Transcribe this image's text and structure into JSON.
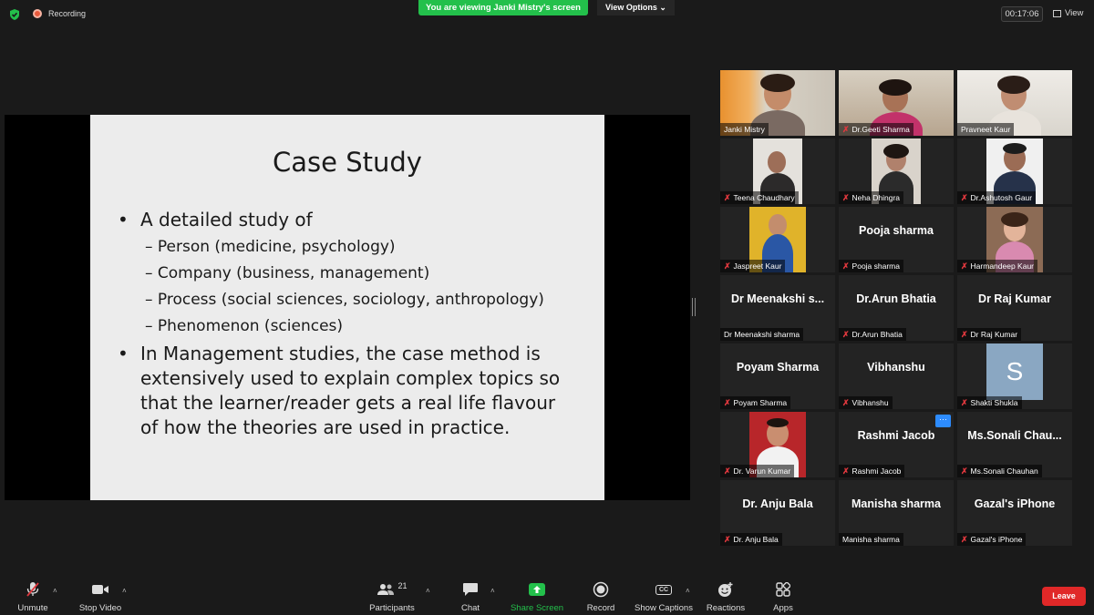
{
  "topbar": {
    "recording": "Recording",
    "viewing_banner": "You are viewing Janki Mistry's screen",
    "view_options": "View Options",
    "timer": "00:17:06",
    "view_label": "View"
  },
  "slide": {
    "title": "Case Study",
    "bullet1": "A detailed study of",
    "subitems": [
      "– Person (medicine, psychology)",
      "– Company (business, management)",
      "– Process (social sciences, sociology, anthropology)",
      "– Phenomenon (sciences)"
    ],
    "bullet2": "In Management studies,  the case method is extensively used to explain complex topics so that the learner/reader gets a real life flavour of how the theories are used in practice."
  },
  "participants": [
    {
      "label": "Janki Mistry",
      "display": "",
      "muted": false
    },
    {
      "label": "Dr.Geeti Sharma",
      "display": "",
      "muted": true
    },
    {
      "label": "Pravneet Kaur",
      "display": "",
      "muted": false
    },
    {
      "label": "Teena Chaudhary",
      "display": "",
      "muted": true
    },
    {
      "label": "Neha Dhingra",
      "display": "",
      "muted": true
    },
    {
      "label": "Dr.Ashutosh Gaur",
      "display": "",
      "muted": true
    },
    {
      "label": "Jaspreet Kaur",
      "display": "",
      "muted": true
    },
    {
      "label": "Pooja sharma",
      "display": "Pooja sharma",
      "muted": true
    },
    {
      "label": "Harmandeep Kaur",
      "display": "",
      "muted": true
    },
    {
      "label": "Dr Meenakshi sharma",
      "display": "Dr  Meenakshi s...",
      "muted": false
    },
    {
      "label": "Dr.Arun Bhatia",
      "display": "Dr.Arun Bhatia",
      "muted": true
    },
    {
      "label": "Dr Raj Kumar",
      "display": "Dr Raj Kumar",
      "muted": true
    },
    {
      "label": "Poyam Sharma",
      "display": "Poyam Sharma",
      "muted": true
    },
    {
      "label": "Vibhanshu",
      "display": "Vibhanshu",
      "muted": true
    },
    {
      "label": "Shakti Shukla",
      "display": "",
      "muted": true,
      "initial": "S"
    },
    {
      "label": "Dr. Varun Kumar",
      "display": "",
      "muted": true
    },
    {
      "label": "Rashmi Jacob",
      "display": "Rashmi Jacob",
      "muted": true
    },
    {
      "label": "Ms.Sonali Chauhan",
      "display": "Ms.Sonali  Chau...",
      "muted": true
    },
    {
      "label": "Dr. Anju Bala",
      "display": "Dr. Anju Bala",
      "muted": true
    },
    {
      "label": "Manisha sharma",
      "display": "Manisha sharma",
      "muted": false
    },
    {
      "label": "Gazal's iPhone",
      "display": "Gazal's iPhone",
      "muted": true
    }
  ],
  "toolbar": {
    "unmute": "Unmute",
    "stop_video": "Stop Video",
    "participants": "Participants",
    "participants_count": "21",
    "chat": "Chat",
    "share_screen": "Share Screen",
    "record": "Record",
    "show_captions": "Show Captions",
    "captions_icon_text": "CC",
    "reactions": "Reactions",
    "apps": "Apps",
    "leave": "Leave"
  },
  "colors": {
    "accent_green": "#23c04b",
    "leave_red": "#e02828",
    "active_speaker": "#d4d94a",
    "mute_red": "#e0383e"
  }
}
